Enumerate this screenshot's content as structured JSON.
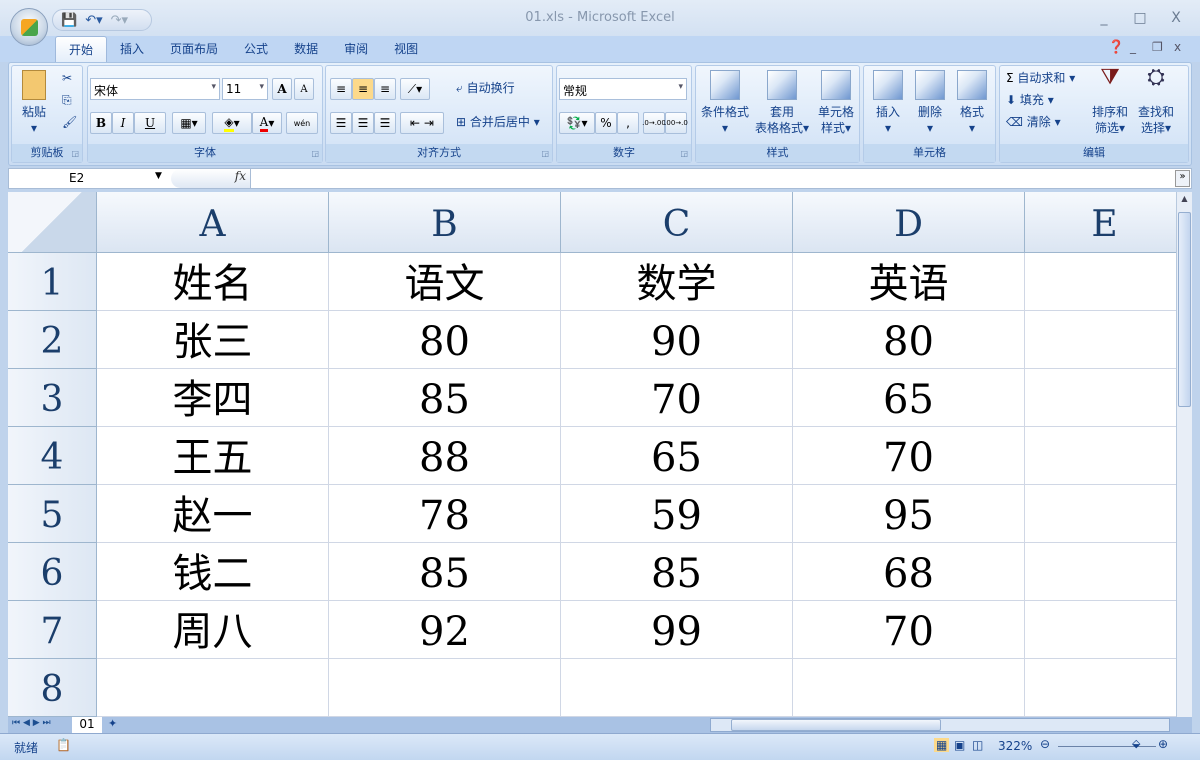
{
  "window": {
    "title": "01.xls - Microsoft Excel",
    "minimize": "_",
    "maximize": "□",
    "close": "X"
  },
  "tabs": [
    "开始",
    "插入",
    "页面布局",
    "公式",
    "数据",
    "审阅",
    "视图"
  ],
  "ribbon": {
    "clipboard": {
      "label": "剪贴板",
      "paste": "粘贴"
    },
    "font": {
      "label": "字体",
      "name": "宋体",
      "size": "11",
      "bold": "B",
      "italic": "I",
      "underline": "U",
      "grow": "A",
      "shrink": "A",
      "font_color": "A",
      "phonetic": "wén"
    },
    "alignment": {
      "label": "对齐方式",
      "wrap": "自动换行",
      "merge": "合并后居中"
    },
    "number": {
      "label": "数字",
      "format": "常规",
      "percent": "%",
      "comma": ",",
      "inc": ".0→.00",
      "dec": ".00→.0"
    },
    "styles": {
      "label": "样式",
      "cond": "条件格式",
      "table1": "套用",
      "table2": "表格格式",
      "cell1": "单元格",
      "cell2": "样式"
    },
    "cells": {
      "label": "单元格",
      "insert": "插入",
      "delete": "删除",
      "format": "格式"
    },
    "editing": {
      "label": "编辑",
      "autosum": "自动求和",
      "fill": "填充",
      "clear": "清除",
      "sort1": "排序和",
      "sort2": "筛选",
      "find1": "查找和",
      "find2": "选择"
    }
  },
  "formula_bar": {
    "name_box": "E2",
    "fx": "fx",
    "value": ""
  },
  "sheet": {
    "columns": [
      "A",
      "B",
      "C",
      "D",
      "E"
    ],
    "rows": [
      "1",
      "2",
      "3",
      "4",
      "5",
      "6",
      "7",
      "8"
    ],
    "cells": [
      [
        "姓名",
        "语文",
        "数学",
        "英语",
        ""
      ],
      [
        "张三",
        "80",
        "90",
        "80",
        ""
      ],
      [
        "李四",
        "85",
        "70",
        "65",
        ""
      ],
      [
        "王五",
        "88",
        "65",
        "70",
        ""
      ],
      [
        "赵一",
        "78",
        "59",
        "95",
        ""
      ],
      [
        "钱二",
        "85",
        "85",
        "68",
        ""
      ],
      [
        "周八",
        "92",
        "99",
        "70",
        ""
      ],
      [
        "",
        "",
        "",
        "",
        ""
      ]
    ]
  },
  "sheet_tabs": [
    "01"
  ],
  "status": {
    "ready": "就绪",
    "zoom": "322%"
  }
}
